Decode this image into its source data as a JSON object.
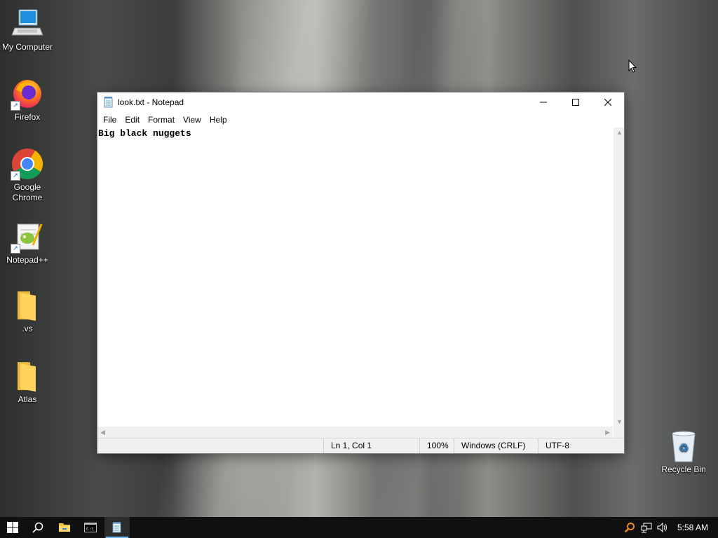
{
  "desktop": {
    "icons": [
      {
        "label": "My Computer",
        "icon": "computer-icon"
      },
      {
        "label": "Firefox",
        "icon": "firefox-icon"
      },
      {
        "label": "Google Chrome",
        "icon": "chrome-icon"
      },
      {
        "label": "Notepad++",
        "icon": "notepadpp-icon"
      },
      {
        "label": ".vs",
        "icon": "folder-icon"
      },
      {
        "label": "Atlas",
        "icon": "folder-icon"
      },
      {
        "label": "Recycle Bin",
        "icon": "recycle-bin-icon"
      }
    ]
  },
  "notepad": {
    "title": "look.txt - Notepad",
    "menu": [
      "File",
      "Edit",
      "Format",
      "View",
      "Help"
    ],
    "content": "Big black nuggets",
    "status": {
      "position": "Ln 1, Col 1",
      "zoom": "100%",
      "line_ending": "Windows (CRLF)",
      "encoding": "UTF-8"
    }
  },
  "taskbar": {
    "clock": "5:58 AM",
    "active_accent": "#76b9ed"
  }
}
